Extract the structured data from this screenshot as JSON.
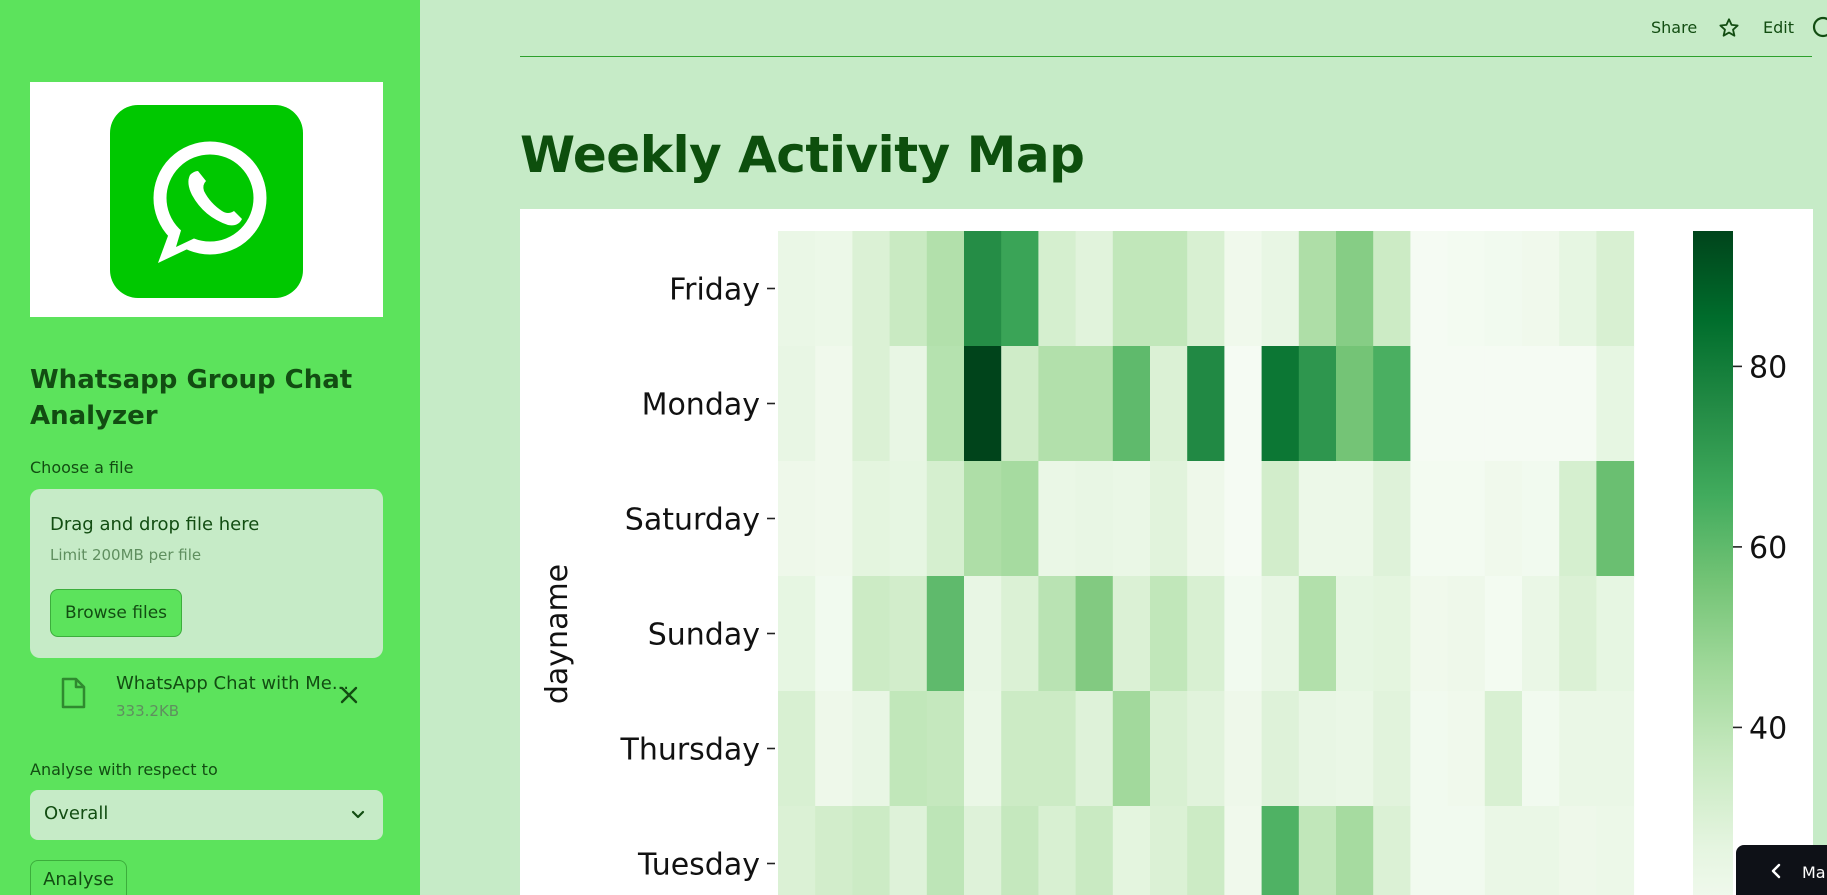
{
  "sidebar": {
    "logo_icon": "whatsapp-logo",
    "app_title": "Whatsapp Group Chat Analyzer",
    "choose_file_label": "Choose a file",
    "dropzone": {
      "title": "Drag and drop file here",
      "limit": "Limit 200MB per file",
      "browse_label": "Browse files"
    },
    "uploaded_file": {
      "name": "WhatsApp Chat with Me...",
      "size": "333.2KB",
      "icon": "file-icon",
      "remove_icon": "close-icon"
    },
    "analyse_label": "Analyse with respect to",
    "select_value": "Overall",
    "analyse_button": "Analyse"
  },
  "header": {
    "share": "Share",
    "star_icon": "star-icon",
    "edit": "Edit",
    "github_icon": "github-icon"
  },
  "main": {
    "title": "Weekly Activity Map"
  },
  "bottom_pill": {
    "icon": "chevron-left-icon",
    "text": "Mar"
  },
  "colors": {
    "sidebar_bg": "#5ce35c",
    "main_bg": "#c6ebc7",
    "title_color": "#0d4f0d",
    "heatmap_cmap": "Greens"
  },
  "chart_data": {
    "type": "heatmap",
    "ylabel": "dayname",
    "rows": [
      "Friday",
      "Monday",
      "Saturday",
      "Sunday",
      "Thursday",
      "Tuesday"
    ],
    "colorbar": {
      "ticks": [
        40,
        60,
        80
      ],
      "min": 17,
      "max": 95
    },
    "values": [
      [
        24,
        23,
        30,
        36,
        42,
        75,
        68,
        32,
        28,
        38,
        38,
        31,
        21,
        25,
        43,
        52,
        35,
        18,
        19,
        20,
        21,
        26,
        31
      ],
      [
        25,
        21,
        30,
        25,
        41,
        95,
        34,
        42,
        42,
        60,
        30,
        76,
        18,
        82,
        72,
        56,
        64,
        18,
        18,
        18,
        18,
        18,
        26
      ],
      [
        22,
        21,
        27,
        26,
        32,
        43,
        45,
        24,
        25,
        24,
        28,
        22,
        18,
        33,
        23,
        23,
        29,
        19,
        19,
        21,
        20,
        32,
        58
      ],
      [
        26,
        20,
        35,
        33,
        60,
        25,
        30,
        40,
        53,
        30,
        38,
        31,
        20,
        25,
        42,
        26,
        27,
        21,
        22,
        19,
        24,
        30,
        26
      ],
      [
        31,
        22,
        25,
        38,
        37,
        24,
        35,
        35,
        29,
        46,
        31,
        28,
        22,
        29,
        25,
        24,
        28,
        20,
        21,
        31,
        20,
        24,
        24
      ],
      [
        30,
        33,
        35,
        29,
        39,
        29,
        37,
        31,
        36,
        27,
        30,
        35,
        21,
        63,
        38,
        45,
        30,
        20,
        20,
        24,
        24,
        22,
        23
      ]
    ]
  }
}
